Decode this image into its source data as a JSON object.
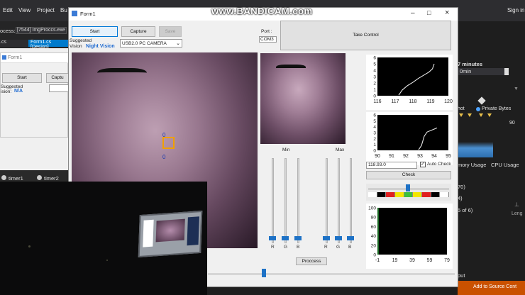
{
  "watermark": "www.BANDICAM.com",
  "vs": {
    "menu": [
      "Edit",
      "View",
      "Project",
      "Bu"
    ],
    "signin": "Sign in",
    "process_label": "ocess:",
    "process_value": "[7544] ImgProccs.exe",
    "tab1": ".cs",
    "tab2": "Form1.cs [Design]",
    "right_minutes": "7 minutes",
    "right_min": "0min",
    "right_snapshot": "hot",
    "right_private": "Private Bytes",
    "right_90": "90",
    "right_mem": "mory Usage",
    "right_cpu": "CPU Usage",
    "right_70": "70)",
    "right_4": "4)",
    "right_6of6": "5 of 6)",
    "right_leng": "Leng",
    "right_output": "put",
    "right_add": "Add to Source Cont",
    "timer1": "timer1",
    "timer2": "timer2"
  },
  "mini_form": {
    "title": "Form1",
    "start": "Start",
    "capture": "Captu",
    "suggested": "Suggested",
    "vision": "ision:",
    "vision_val": "N/A"
  },
  "form": {
    "title": "Form1",
    "start": "Start",
    "capture": "Capture",
    "save": "Save",
    "port_label": "Port :",
    "port_value": "COM3",
    "take_control": "Take Control",
    "suggested_label": "Suggested",
    "vision_label": "Vision",
    "vision_value": "Night Vision",
    "camera_select": "USB2.0 PC CAMERA",
    "marker_top": "0",
    "marker_bottom": "0",
    "min_label": "Min",
    "max_label": "Max",
    "r": "R",
    "g": "G",
    "b": "B",
    "proccess": "Proccess",
    "value_input": "118.93.0",
    "auto_check": "Auto Check",
    "check": "Check"
  },
  "chart_data": [
    {
      "type": "line",
      "x_ticks": [
        "116",
        "117",
        "118",
        "119",
        "120"
      ],
      "y_ticks": [
        "0",
        "1",
        "2",
        "3",
        "4",
        "5",
        "6"
      ],
      "xlim": [
        116,
        120
      ],
      "ylim": [
        0,
        6
      ],
      "x": [
        117.2,
        117.4,
        117.7,
        118.0,
        118.3,
        118.6,
        118.9,
        119.1,
        119.2
      ],
      "y": [
        0.1,
        0.9,
        1.6,
        2.1,
        2.7,
        3.2,
        3.7,
        4.2,
        5.0
      ]
    },
    {
      "type": "line",
      "x_ticks": [
        "90",
        "91",
        "92",
        "93",
        "94",
        "95"
      ],
      "y_ticks": [
        "0",
        "1",
        "2",
        "3",
        "4",
        "5",
        "6"
      ],
      "xlim": [
        90,
        95
      ],
      "ylim": [
        0,
        6
      ],
      "x": [
        92.9,
        93.1,
        93.2,
        93.3,
        93.5,
        93.9,
        94.2
      ],
      "y": [
        0.1,
        0.8,
        1.6,
        2.4,
        3.1,
        3.5,
        3.8
      ]
    },
    {
      "type": "bar",
      "x_ticks": [
        "-1",
        "19",
        "39",
        "59",
        "79"
      ],
      "y_ticks": [
        "0",
        "20",
        "40",
        "60",
        "80",
        "100"
      ],
      "xlim": [
        -1,
        89
      ],
      "ylim": [
        0,
        100
      ],
      "values": []
    }
  ],
  "color_strip": [
    "#ffffff",
    "#000000",
    "#e02020",
    "#f2e600",
    "#3cc03c",
    "#f2e600",
    "#e02020",
    "#000000",
    "#ffffff"
  ]
}
